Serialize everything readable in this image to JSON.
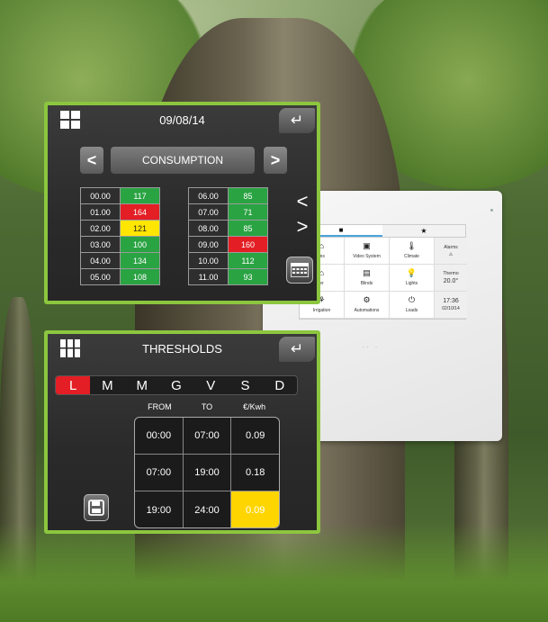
{
  "consumption_panel": {
    "date": "09/08/14",
    "back_glyph": "↵",
    "home_icon": "grid-icon",
    "mode_label": "CONSUMPTION",
    "prev_glyph": "<",
    "next_glyph": ">",
    "left_column": [
      {
        "hour": "00.00",
        "value": "117",
        "status": "green"
      },
      {
        "hour": "01.00",
        "value": "164",
        "status": "red"
      },
      {
        "hour": "02.00",
        "value": "121",
        "status": "yellow"
      },
      {
        "hour": "03.00",
        "value": "100",
        "status": "green"
      },
      {
        "hour": "04.00",
        "value": "134",
        "status": "green"
      },
      {
        "hour": "05.00",
        "value": "108",
        "status": "green"
      }
    ],
    "right_column": [
      {
        "hour": "06.00",
        "value": "85",
        "status": "green"
      },
      {
        "hour": "07.00",
        "value": "71",
        "status": "green"
      },
      {
        "hour": "08.00",
        "value": "85",
        "status": "green"
      },
      {
        "hour": "09.00",
        "value": "160",
        "status": "red"
      },
      {
        "hour": "10.00",
        "value": "112",
        "status": "green"
      },
      {
        "hour": "11.00",
        "value": "93",
        "status": "green"
      }
    ],
    "scroll_up_glyph": "<",
    "scroll_down_glyph": ">",
    "calendar_icon": "calendar-icon"
  },
  "thresholds_panel": {
    "title": "THRESHOLDS",
    "back_glyph": "↵",
    "days": [
      "L",
      "M",
      "M",
      "G",
      "V",
      "S",
      "D"
    ],
    "active_day_index": 0,
    "columns": [
      "FROM",
      "TO",
      "€/Kwh"
    ],
    "rows": [
      {
        "from": "00:00",
        "to": "07:00",
        "price": "0.09",
        "highlight": false
      },
      {
        "from": "07:00",
        "to": "19:00",
        "price": "0.18",
        "highlight": false
      },
      {
        "from": "19:00",
        "to": "24:00",
        "price": "0.09",
        "highlight": true
      }
    ],
    "save_icon": "save-icon"
  },
  "device_screen": {
    "tabs": [
      "■",
      "★"
    ],
    "cells": [
      {
        "glyph": "⌂",
        "label": "ms"
      },
      {
        "glyph": "▣",
        "label": "Video System"
      },
      {
        "glyph": "🌡",
        "label": "Climate"
      },
      {
        "glyph": "⌂",
        "label": "er"
      },
      {
        "glyph": "▤",
        "label": "Blinds"
      },
      {
        "glyph": "💡",
        "label": "Lights"
      },
      {
        "glyph": "⚘",
        "label": "Irrigation"
      },
      {
        "glyph": "⚙",
        "label": "Automations"
      },
      {
        "glyph": "⏻",
        "label": "Loads"
      }
    ],
    "light_counter": "5\n30",
    "side": {
      "alarms_label": "Alarms",
      "thermo_label": "Thermo",
      "temperature": "20.0°",
      "time": "17:36",
      "date": "02/10/14"
    }
  },
  "colors": {
    "panel_border": "#8cc63f",
    "green": "#2aa343",
    "red": "#e31e24",
    "yellow": "#ffe600"
  }
}
